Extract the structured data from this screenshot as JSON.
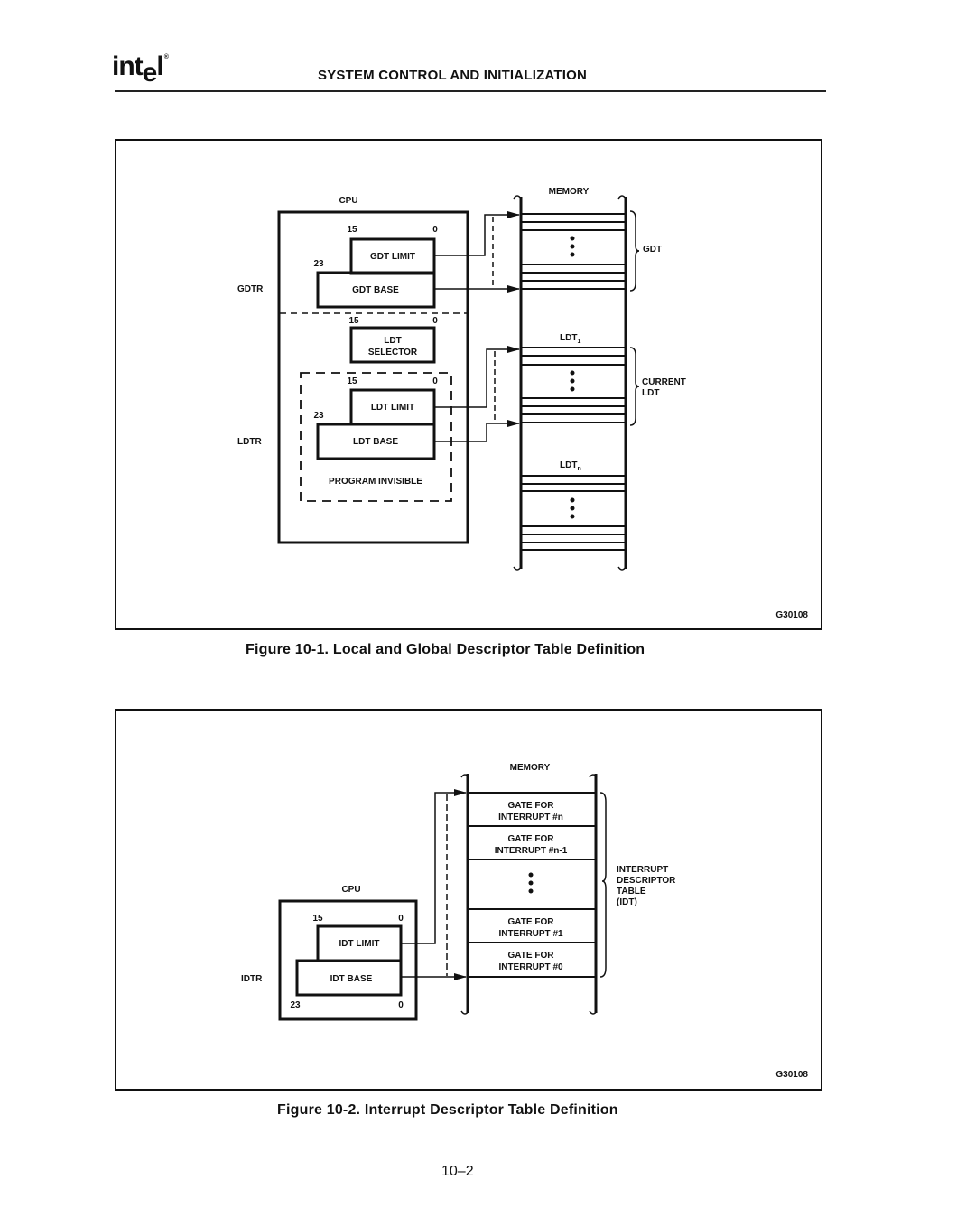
{
  "header": {
    "logo": "intel",
    "title": "SYSTEM CONTROL AND INITIALIZATION"
  },
  "figure1": {
    "cpu_label": "CPU",
    "memory_label": "MEMORY",
    "gdtr_label": "GDTR",
    "ldtr_label": "LDTR",
    "gdt_limit": "GDT LIMIT",
    "gdt_base": "GDT BASE",
    "ldt_selector_line1": "LDT",
    "ldt_selector_line2": "SELECTOR",
    "ldt_limit": "LDT LIMIT",
    "ldt_base": "LDT BASE",
    "program_invisible": "PROGRAM INVISIBLE",
    "bit15": "15",
    "bit0": "0",
    "bit23": "23",
    "gdt_brace_label": "GDT",
    "ldt1_label": "LDT",
    "ldt1_sub": "1",
    "ldtn_label": "LDT",
    "ldtn_sub": "n",
    "current_ldt_line1": "CURRENT",
    "current_ldt_line2": "LDT",
    "figure_code": "G30108",
    "caption": "Figure 10-1.  Local and Global Descriptor Table Definition"
  },
  "figure2": {
    "cpu_label": "CPU",
    "memory_label": "MEMORY",
    "idtr_label": "IDTR",
    "idt_limit": "IDT LIMIT",
    "idt_base": "IDT BASE",
    "bit15": "15",
    "bit0": "0",
    "bit23": "23",
    "gates": [
      {
        "line1": "GATE FOR",
        "line2": "INTERRUPT #n"
      },
      {
        "line1": "GATE FOR",
        "line2": "INTERRUPT #n-1"
      },
      {
        "line1": "GATE FOR",
        "line2": "INTERRUPT #1"
      },
      {
        "line1": "GATE FOR",
        "line2": "INTERRUPT #0"
      }
    ],
    "idt_label_lines": [
      "INTERRUPT",
      "DESCRIPTOR",
      "TABLE",
      "(IDT)"
    ],
    "figure_code": "G30108",
    "caption": "Figure 10-2.  Interrupt Descriptor Table Definition"
  },
  "footer": {
    "page_number": "10–2"
  }
}
